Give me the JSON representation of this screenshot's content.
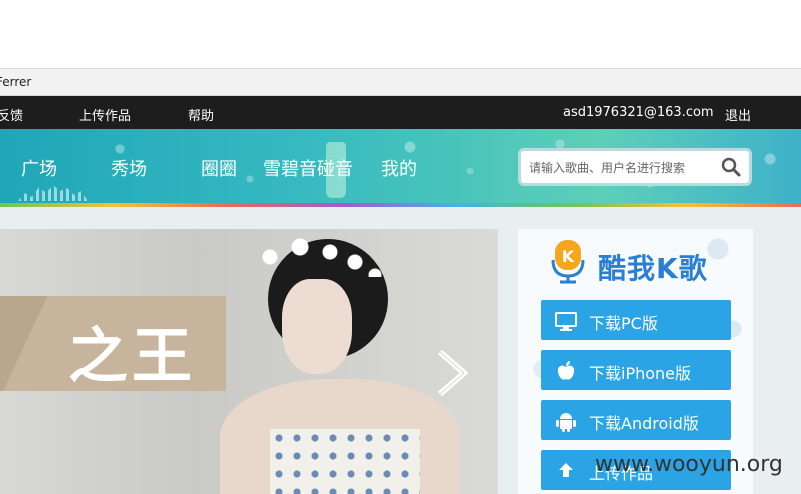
{
  "address_bar": {
    "text": "Ferrer"
  },
  "topbar": {
    "feedback": "反馈",
    "upload_work": "上传作品",
    "help": "帮助",
    "user_email": "asd1976321@163.com",
    "logout": "退出"
  },
  "main_nav": [
    {
      "label": "广场"
    },
    {
      "label": "秀场"
    },
    {
      "label": "圈圈"
    },
    {
      "label": "雪碧音碰音"
    },
    {
      "label": "我的"
    }
  ],
  "search": {
    "placeholder": "请输入歌曲、用户名进行搜索",
    "icon": "search-icon"
  },
  "hero": {
    "title": "之王",
    "next_icon": "chevron-right-icon"
  },
  "sidebar": {
    "app_name": "酷我K歌",
    "logo_icon": "microphone-k-icon",
    "buttons": [
      {
        "label": "下载PC版",
        "icon": "monitor-icon"
      },
      {
        "label": "下载iPhone版",
        "icon": "apple-icon"
      },
      {
        "label": "下载Android版",
        "icon": "android-icon"
      },
      {
        "label": "上传作品",
        "icon": "upload-icon"
      }
    ]
  },
  "watermark": "www.wooyun.org",
  "colors": {
    "topbar_bg": "#1d1d1d",
    "banner_teal": "#35b8c1",
    "button_blue": "#2aa4e4",
    "logo_blue": "#2a7fd3",
    "logo_orange": "#f7a51c"
  }
}
